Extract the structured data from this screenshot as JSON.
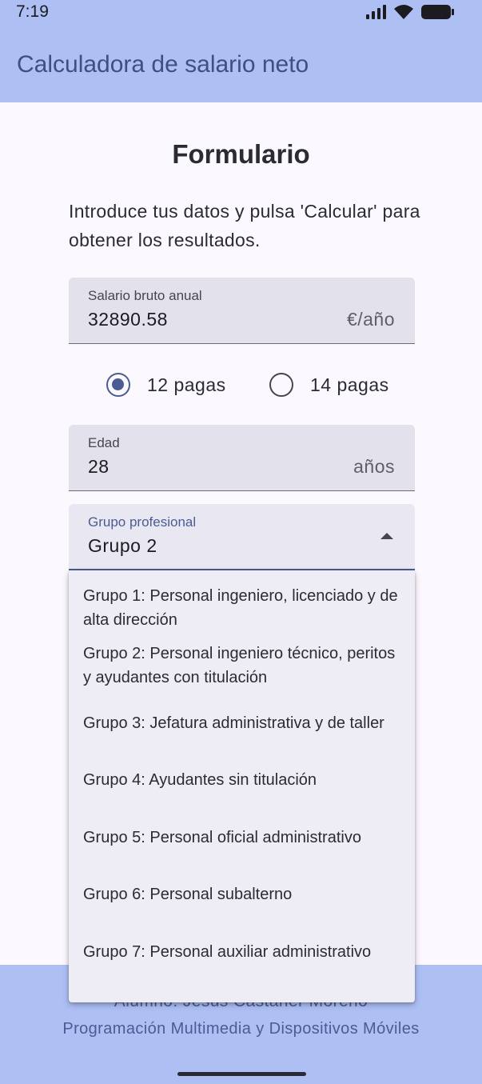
{
  "status": {
    "time": "7:19"
  },
  "appbar": {
    "title": "Calculadora de salario neto"
  },
  "form": {
    "title": "Formulario",
    "intro": "Introduce tus datos y pulsa 'Calcular' para obtener los resultados.",
    "salary": {
      "label": "Salario bruto anual",
      "value": "32890.58",
      "suffix": "€/año"
    },
    "payments": {
      "options": [
        "12 pagas",
        "14 pagas"
      ],
      "selected": "12 pagas"
    },
    "age": {
      "label": "Edad",
      "value": "28",
      "suffix": "años"
    },
    "group": {
      "label": "Grupo profesional",
      "value": "Grupo 2"
    }
  },
  "menu": {
    "items": [
      "Grupo 1: Personal ingeniero, licenciado y de alta dirección",
      "Grupo 2: Personal ingeniero técnico, peritos y ayudantes con titulación",
      "Grupo 3: Jefatura administrativa y de taller",
      "Grupo 4: Ayudantes sin titulación",
      "Grupo 5: Personal oficial administrativo",
      "Grupo 6: Personal subalterno",
      "Grupo 7: Personal auxiliar administrativo"
    ]
  },
  "footer": {
    "author": "Alumno: Jesús Castañer Moreno",
    "course": "Programación Multimedia y Dispositivos Móviles"
  },
  "colors": {
    "primary": "#4b5c92",
    "bars": "#adbff3",
    "surface": "#fbf8fe"
  },
  "icons": [
    "signal-icon",
    "wifi-icon",
    "battery-icon",
    "dropdown-arrow-icon"
  ]
}
